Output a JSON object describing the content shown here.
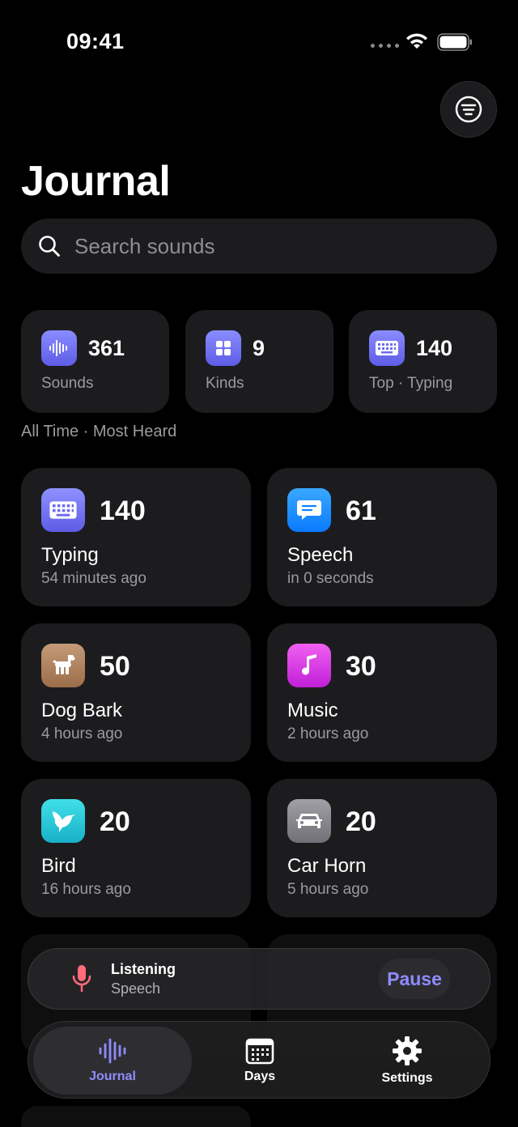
{
  "status": {
    "time": "09:41"
  },
  "header": {
    "title": "Journal"
  },
  "search": {
    "placeholder": "Search sounds"
  },
  "stats": [
    {
      "value": "361",
      "label": "Sounds",
      "icon": "waveform-icon"
    },
    {
      "value": "9",
      "label": "Kinds",
      "icon": "grid-icon"
    },
    {
      "value": "140",
      "label": "Top · Typing",
      "icon": "keyboard-icon"
    }
  ],
  "caption": "All Time · Most Heard",
  "sounds": [
    {
      "count": "140",
      "name": "Typing",
      "time": "54 minutes ago",
      "icon": "keyboard-icon",
      "color": "#7a7cff"
    },
    {
      "count": "61",
      "name": "Speech",
      "time": "in 0 seconds",
      "icon": "speech-bubble-icon",
      "color": "#0a84ff"
    },
    {
      "count": "50",
      "name": "Dog Bark",
      "time": "4 hours ago",
      "icon": "dog-icon",
      "color": "#b08060"
    },
    {
      "count": "30",
      "name": "Music",
      "time": "2 hours ago",
      "icon": "music-note-icon",
      "color": "#e040e8"
    },
    {
      "count": "20",
      "name": "Bird",
      "time": "16 hours ago",
      "icon": "bird-icon",
      "color": "#30c8d8"
    },
    {
      "count": "20",
      "name": "Car Horn",
      "time": "5 hours ago",
      "icon": "car-icon",
      "color": "#8e8e93"
    }
  ],
  "now_playing": {
    "title": "Listening",
    "subtitle": "Speech",
    "action": "Pause"
  },
  "tabs": [
    {
      "label": "Journal",
      "icon": "waveform-icon",
      "active": true
    },
    {
      "label": "Days",
      "icon": "calendar-icon",
      "active": false
    },
    {
      "label": "Settings",
      "icon": "gear-icon",
      "active": false
    }
  ],
  "colors": {
    "accent": "#8e8cff",
    "background": "#000000",
    "card": "#1c1c1e"
  }
}
